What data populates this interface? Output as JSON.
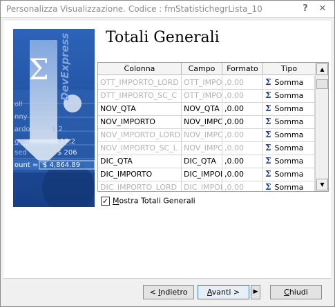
{
  "window": {
    "title": "Personalizza Visualizzazione. Codice : fmStatistichegrLista_10",
    "help_label": "?",
    "close_label": "✕"
  },
  "page": {
    "heading": "Totali Generali"
  },
  "banner": {
    "brand_text": "DevExpress",
    "sigma": "Σ",
    "bg_labels": [
      "oll",
      "nny",
      "ardo",
      "ger",
      "sed"
    ],
    "values": [
      "$ 2",
      "$ 117.2",
      "$ 206"
    ],
    "total_label": "ount =",
    "total_value": "$ 4,864.89"
  },
  "grid": {
    "columns": [
      "Colonna",
      "Campo",
      "Formato",
      "Tipo"
    ],
    "rows": [
      {
        "colonna": "OTT_IMPORTO_LORD",
        "campo": "OTT_IMPO",
        "formato": ",0.00",
        "tipo": "Somma",
        "enabled": false
      },
      {
        "colonna": "OTT_IMPORTO_SC_C",
        "campo": "OTT_IMPO",
        "formato": ",0.00",
        "tipo": "Somma",
        "enabled": false
      },
      {
        "colonna": "NOV_QTA",
        "campo": "NOV_QTA",
        "formato": ",0.00",
        "tipo": "Somma",
        "enabled": true
      },
      {
        "colonna": "NOV_IMPORTO",
        "campo": "NOV_IMPO",
        "formato": ",0.00",
        "tipo": "Somma",
        "enabled": true
      },
      {
        "colonna": "NOV_IMPORTO_LORD",
        "campo": "NOV_IMPO",
        "formato": ",0.00",
        "tipo": "Somma",
        "enabled": false
      },
      {
        "colonna": "NOV_IMPORTO_SC_L",
        "campo": "NOV_IMPO",
        "formato": ",0.00",
        "tipo": "Somma",
        "enabled": false
      },
      {
        "colonna": "DIC_QTA",
        "campo": "DIC_QTA",
        "formato": ",0.00",
        "tipo": "Somma",
        "enabled": true
      },
      {
        "colonna": "DIC_IMPORTO",
        "campo": "DIC_IMPOF",
        "formato": ",0.00",
        "tipo": "Somma",
        "enabled": true
      },
      {
        "colonna": "DIC_IMPORTO_LORD",
        "campo": "DIC_IMPOF",
        "formato": ",0.00",
        "tipo": "Somma",
        "enabled": false
      }
    ],
    "sigma": "Σ",
    "scroll_up": "▲",
    "scroll_down": "▼"
  },
  "checkbox": {
    "label": "Mostra Totali Generali",
    "mnemonic": "M",
    "rest": "ostra Totali Generali",
    "checked": true,
    "mark": "✓"
  },
  "buttons": {
    "back": {
      "prefix": "< ",
      "mnemonic": "I",
      "rest": "ndietro"
    },
    "next": {
      "mnemonic": "A",
      "rest": "vanti >"
    },
    "next_arrow": "▶",
    "close": {
      "mnemonic": "C",
      "rest": "hiudi"
    }
  },
  "colors": {
    "banner_blue": "#1f55a7",
    "sigma_blue": "#1b3a8c",
    "disabled_text": "#b4b4b4"
  }
}
